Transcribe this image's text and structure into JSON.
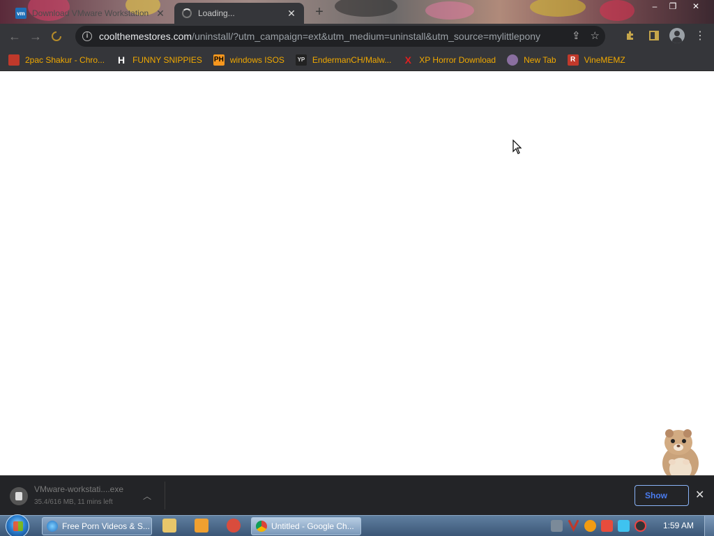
{
  "tabs": [
    {
      "title": "Download VMware Workstation",
      "favicon": "vmware-icon",
      "active": false
    },
    {
      "title": "Loading...",
      "favicon": "loading-spinner",
      "active": true
    }
  ],
  "window_controls": {
    "minimize": "–",
    "maximize": "❐",
    "close": "✕"
  },
  "address_bar": {
    "host": "coolthemestores.com",
    "path": "/uninstall/?utm_campaign=ext&utm_medium=uninstall&utm_source=mylittlepony"
  },
  "bookmarks": [
    {
      "label": "2pac Shakur - Chro...",
      "icon": "app-icon",
      "icon_text": "",
      "icon_color": "#c0392b"
    },
    {
      "label": "FUNNY SNIPPIES",
      "icon": "h-icon",
      "icon_text": "H",
      "icon_color": "#ffffff"
    },
    {
      "label": "windows ISOS",
      "icon": "ph-icon",
      "icon_text": "PH",
      "icon_color": "#f7971e"
    },
    {
      "label": "EndermanCH/Malw...",
      "icon": "yp-icon",
      "icon_text": "YP",
      "icon_color": "#222222"
    },
    {
      "label": "XP Horror Download",
      "icon": "x-icon",
      "icon_text": "X",
      "icon_color": "#e02020"
    },
    {
      "label": "New Tab",
      "icon": "globe-icon",
      "icon_text": "",
      "icon_color": "#8a6fa0"
    },
    {
      "label": "VineMEMZ",
      "icon": "r-icon",
      "icon_text": "R",
      "icon_color": "#c0392b"
    }
  ],
  "download": {
    "filename": "VMware-workstati....exe",
    "status": "35.4/616 MB, 11 mins left",
    "show_all_label": "Show"
  },
  "taskbar": {
    "items": [
      {
        "label": "Free Porn Videos & S...",
        "icon": "ie-icon"
      },
      {
        "label": "Untitled - Google Ch...",
        "icon": "chrome-icon"
      }
    ],
    "clock": "1:59 AM"
  },
  "colors": {
    "bookmark_text": "#f1a900",
    "chrome_dark": "#35363a",
    "omnibox": "#202124",
    "showall_blue": "#4a7cf0"
  }
}
